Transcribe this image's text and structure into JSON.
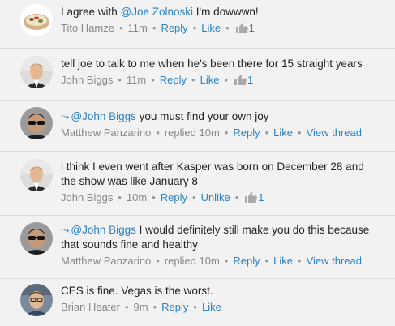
{
  "comments": [
    {
      "author": "Tito Hamze",
      "mention": "@Joe Zolnoski",
      "text_before": "I agree with ",
      "text_after": " I'm dowwwn!",
      "time": "11m",
      "reply_label": "Reply",
      "like_label": "Like",
      "like_count": "1"
    },
    {
      "author": "John Biggs",
      "text": "tell joe to talk to me when he's been there for 15 straight years",
      "time": "11m",
      "reply_label": "Reply",
      "like_label": "Like",
      "like_count": "1"
    },
    {
      "author": "Matthew Panzarino",
      "reply_glyph": "⤳",
      "mention": "@John Biggs",
      "text_after": " you must find your own joy",
      "time": "replied 10m",
      "reply_label": "Reply",
      "like_label": "Like",
      "thread_label": "View thread"
    },
    {
      "author": "John Biggs",
      "text_line1": "i think I even went after Kasper was born on December 28 and",
      "text_line2": "the show was like January 8",
      "time": "10m",
      "reply_label": "Reply",
      "like_label": "Unlike",
      "like_count": "1"
    },
    {
      "author": "Matthew Panzarino",
      "reply_glyph": "⤳",
      "mention": "@John Biggs",
      "text_after": " I would definitely still make you do this because",
      "text_line2": "that sounds fine and healthy",
      "time": "replied 10m",
      "reply_label": "Reply",
      "like_label": "Like",
      "thread_label": "View thread"
    },
    {
      "author": "Brian Heater",
      "text": "CES is fine. Vegas is the worst.",
      "time": "9m",
      "reply_label": "Reply",
      "like_label": "Like"
    }
  ],
  "separator": "•",
  "icons": {
    "like": "thumbs-up-icon"
  },
  "colors": {
    "link": "#2a82c9",
    "meta": "#888888",
    "text": "#222222",
    "background": "#f2f2f2"
  }
}
